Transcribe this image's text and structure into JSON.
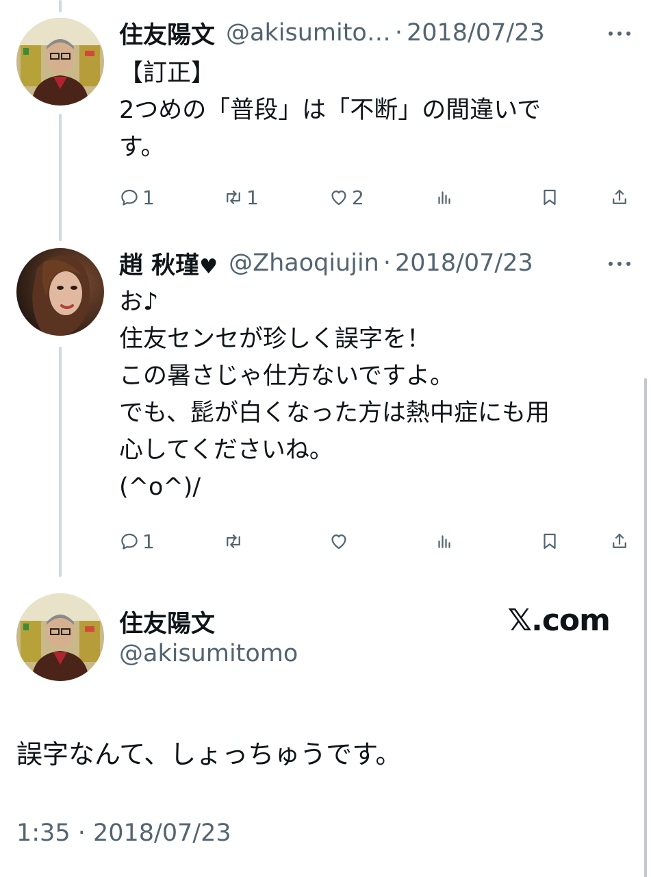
{
  "tweet1": {
    "name": "住友陽文",
    "handle": "@akisumito…",
    "dot": "·",
    "date": "2018/07/23",
    "text_lines": [
      "【訂正】",
      "2つめの「普段」は「不断」の間違いで",
      "す。"
    ],
    "reply_count": "1",
    "retweet_count": "1",
    "like_count": "2"
  },
  "tweet2": {
    "name": "趙 秋瑾",
    "name_heart": "♥",
    "handle": "@Zhaoqiujin",
    "dot": "·",
    "date": "2018/07/23",
    "text_lines": [
      "お♪",
      "住友センセが珍しく誤字を！",
      "この暑さじゃ仕方ないですよ。",
      "でも、髭が白くなった方は熱中症にも用",
      "心してくださいね。",
      "(^o^)/"
    ],
    "reply_count": "1",
    "retweet_count": "",
    "like_count": ""
  },
  "main_tweet": {
    "name": "住友陽文",
    "handle": "@akisumitomo",
    "brand": "𝕏.com",
    "text": "誤字なんて、しょっちゅうです。",
    "meta": "1:35 · 2018/07/23"
  },
  "icons": {
    "reply": "reply-icon",
    "retweet": "retweet-icon",
    "like": "heart-icon",
    "views": "views-icon",
    "bookmark": "bookmark-icon",
    "share": "share-icon",
    "more": "more-icon"
  },
  "colors": {
    "text_primary": "#0f1419",
    "text_secondary": "#536471",
    "thread_line": "#cfd9de",
    "background": "#ffffff"
  }
}
